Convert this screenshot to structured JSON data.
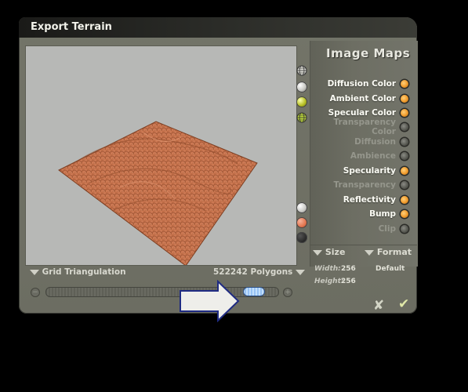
{
  "window": {
    "title": "Export Terrain"
  },
  "panel": {
    "title": "Image Maps",
    "maps": [
      {
        "label": "Diffusion Color",
        "enabled": true
      },
      {
        "label": "Ambient Color",
        "enabled": true
      },
      {
        "label": "Specular Color",
        "enabled": true
      },
      {
        "label": "Transparency Color",
        "enabled": false
      },
      {
        "label": "Diffusion",
        "enabled": false
      },
      {
        "label": "Ambience",
        "enabled": false
      },
      {
        "label": "Specularity",
        "enabled": true
      },
      {
        "label": "Transparency",
        "enabled": false
      },
      {
        "label": "Reflectivity",
        "enabled": true
      },
      {
        "label": "Bump",
        "enabled": true
      },
      {
        "label": "Clip",
        "enabled": false
      }
    ],
    "size_label": "Size",
    "format_label": "Format",
    "width_label": "Width:",
    "width_value": "256",
    "height_label": "Height:",
    "height_value": "256",
    "format_value": "Default"
  },
  "viewport": {
    "triangulation_label": "Grid Triangulation",
    "polygons_label": "522242 Polygons",
    "resolution_level": 0.93
  },
  "icons": {
    "globe_wire": "globe-wireframe-icon",
    "sphere_white": "sphere-white-icon",
    "sphere_yellow": "sphere-yellow-icon",
    "globe_green": "globe-green-icon"
  },
  "actions": {
    "cancel_glyph": "✘",
    "ok_glyph": "✔"
  },
  "colors": {
    "terrain": "#c9734f",
    "accent_on": "#f09a2a"
  }
}
